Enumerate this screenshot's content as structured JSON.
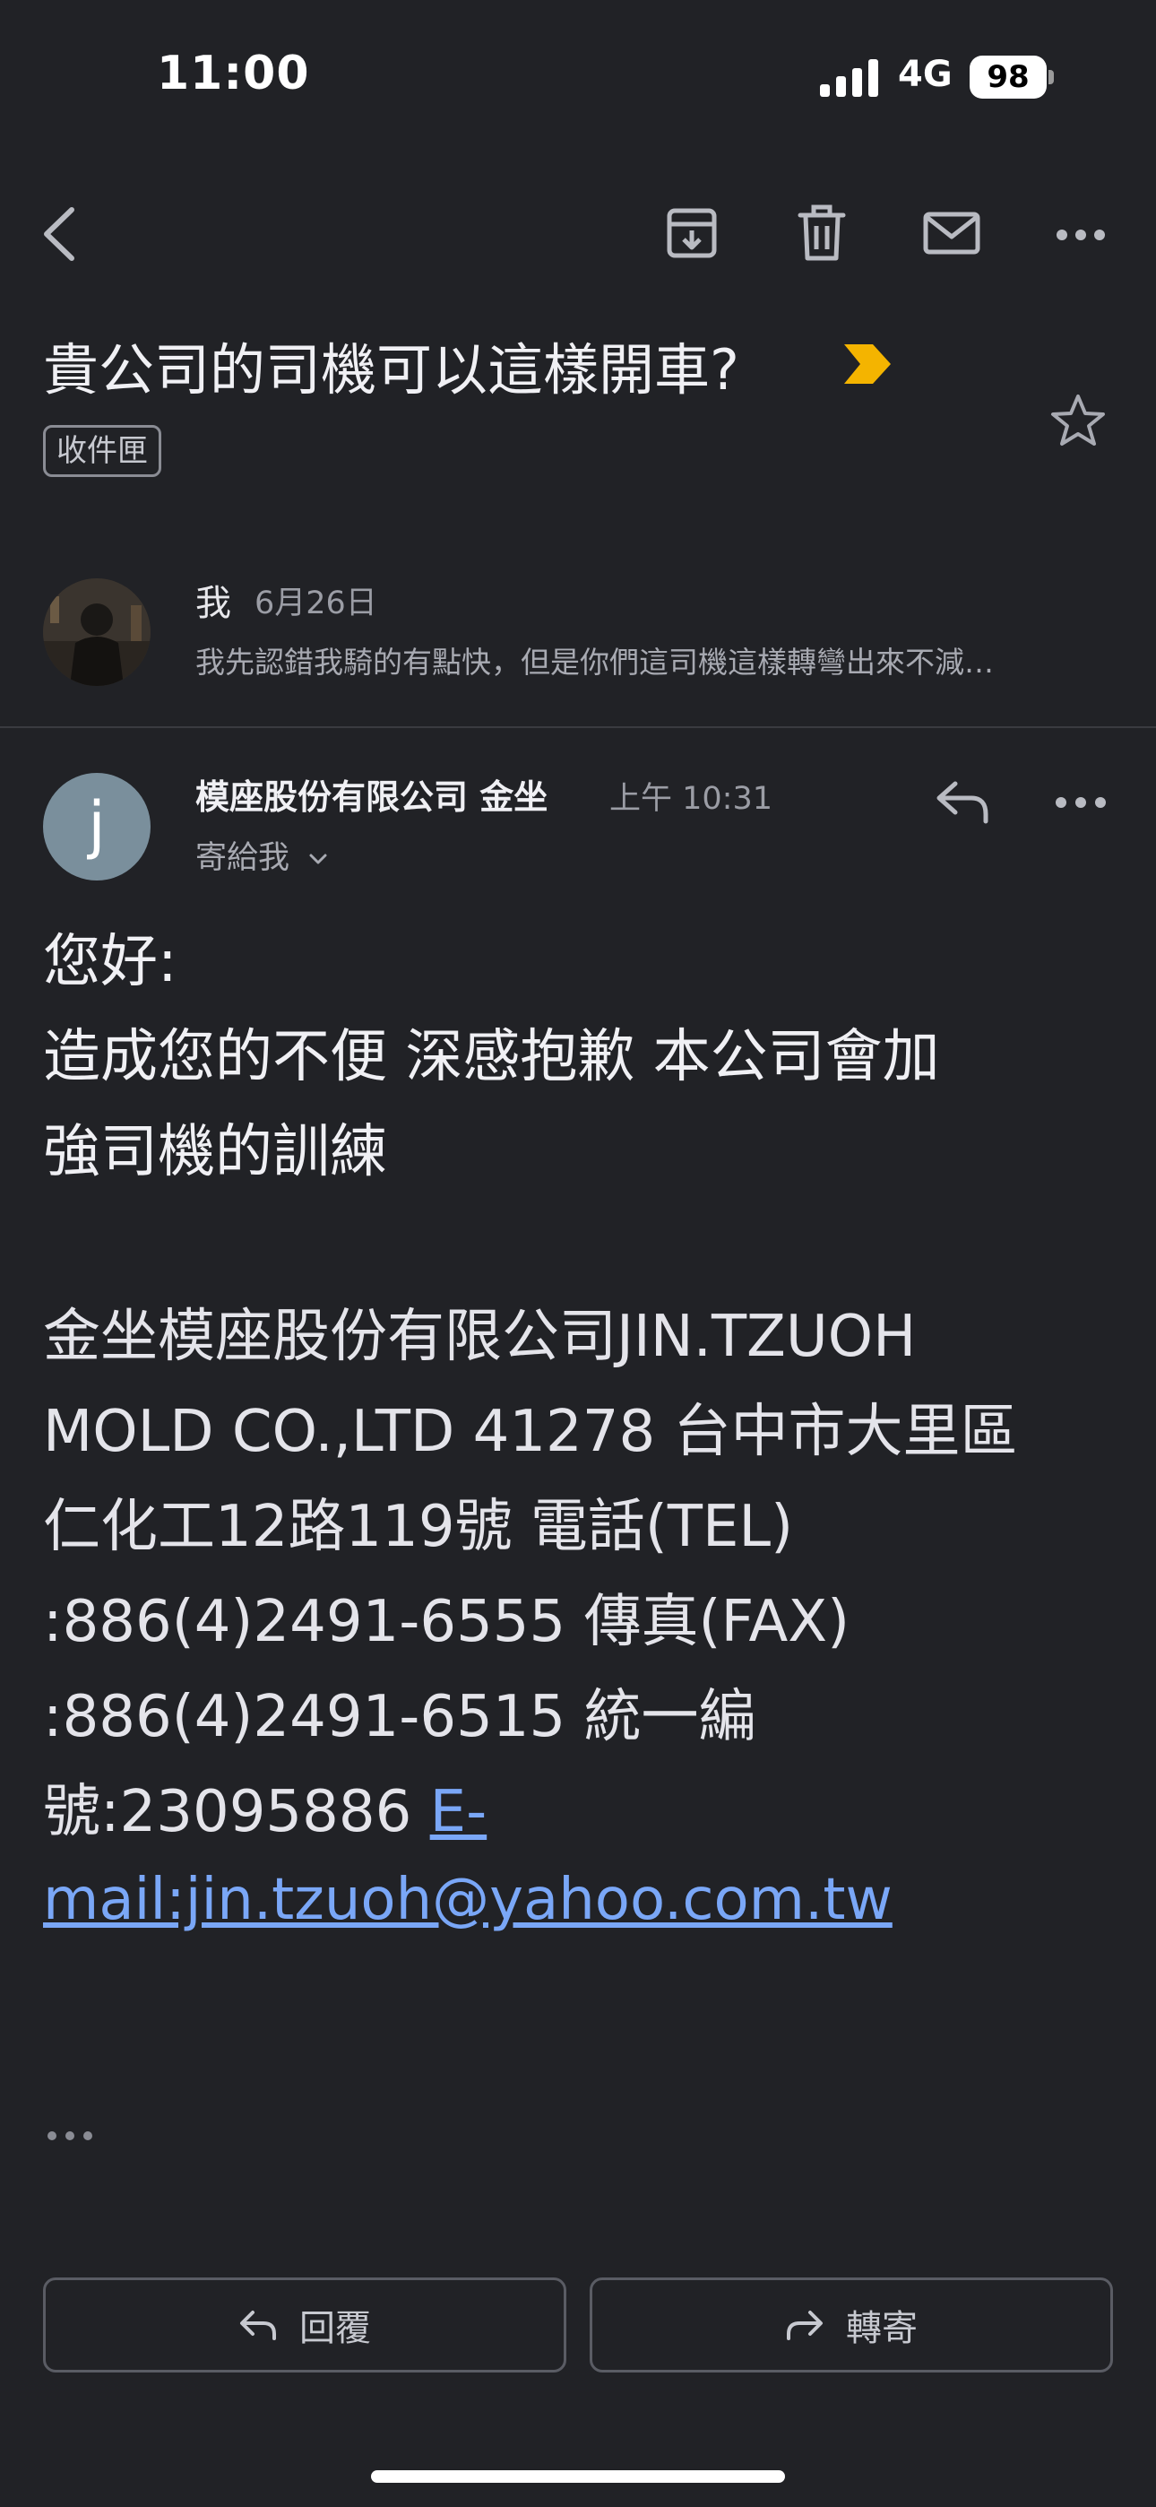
{
  "status_bar": {
    "time": "11:00",
    "network": "4G",
    "battery": "98"
  },
  "toolbar": {
    "back_icon": "chevron-left-icon",
    "archive_icon": "archive-icon",
    "delete_icon": "trash-icon",
    "mark_unread_icon": "mail-icon",
    "more_icon": "more-horizontal-icon"
  },
  "thread": {
    "subject": "貴公司的司機可以這樣開車?",
    "label": "收件匣",
    "importance_color": "#f4b400"
  },
  "collapsed_message": {
    "sender": "我",
    "date": "6月26日",
    "preview": "我先認錯我騎的有點快，但是你們這司機這樣轉彎出來不減…"
  },
  "message": {
    "avatar_letter": "j",
    "sender": "模座股份有限公司 金坐",
    "time": "上午 10:31",
    "recipients": "寄給我",
    "body": {
      "greeting": "您好:",
      "line1": "造成您的不便 深感抱歉 本公司會加",
      "line2": "強司機的訓練",
      "sig1": "金坐模座股份有限公司JIN.TZUOH",
      "sig2": "MOLD CO.,LTD 41278 台中市大里區",
      "sig3": "仁化工12路119號 電話(TEL)",
      "sig4": ":886(4)2491-6555 傳真(FAX)",
      "sig5": ":886(4)2491-6515 統一編",
      "sig6_text": "號:23095886 ",
      "sig6_link": "E-",
      "sig7_link": "mail:jin.tzuoh@yahoo.com.tw"
    }
  },
  "actions": {
    "reply": "回覆",
    "forward": "轉寄"
  },
  "colors": {
    "background": "#212226",
    "link": "#7aa7f7",
    "avatar": "#7a8f9c"
  }
}
